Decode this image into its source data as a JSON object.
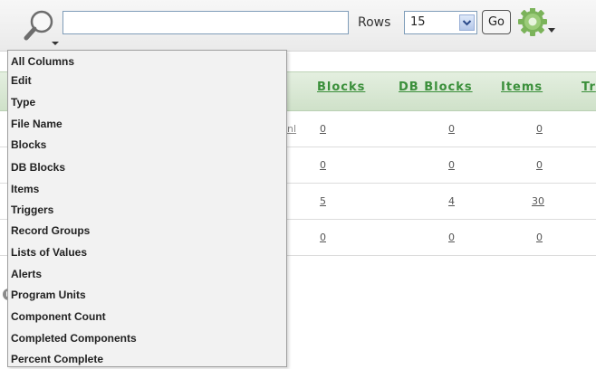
{
  "toolbar": {
    "search_value": "",
    "rows_label": "Rows",
    "rows_value": "15",
    "go_label": "Go"
  },
  "columns_menu": {
    "items": [
      "All Columns",
      "Edit",
      "Type",
      "File Name",
      "Blocks",
      "DB Blocks",
      "Items",
      "Triggers",
      "Record Groups",
      "Lists of Values",
      "Alerts",
      "Program Units",
      "Component Count",
      "Completed Components",
      "Percent Complete"
    ]
  },
  "report": {
    "headers": [
      "Blocks",
      "DB Blocks",
      "Items",
      "Tr"
    ],
    "partial_cell": "nl",
    "rows": [
      [
        "0",
        "0",
        "0"
      ],
      [
        "0",
        "0",
        "0"
      ],
      [
        "5",
        "4",
        "30"
      ],
      [
        "0",
        "0",
        "0"
      ]
    ]
  }
}
